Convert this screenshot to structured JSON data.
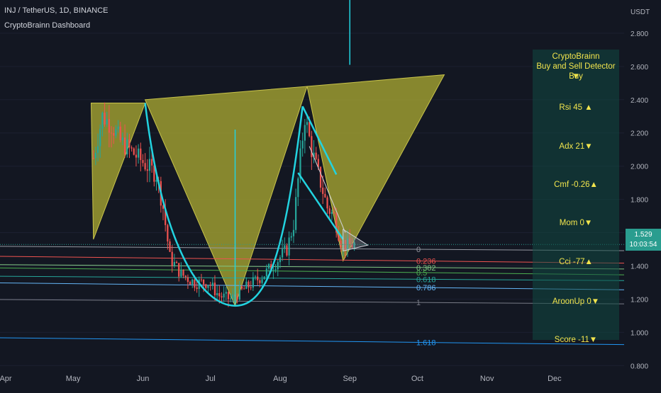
{
  "header": {
    "symbol": "INJ / TetherUS, 1D, BINANCE",
    "indicator": "CryptoBrainn Dashboard"
  },
  "price_tag": {
    "price": "1.529",
    "countdown": "10:03:54"
  },
  "dashboard": {
    "title1": "CryptoBrainn",
    "title2": "Buy and Sell Detector  Buy",
    "title_arrow": "▼",
    "rows": [
      {
        "label": "Rsi  45 ▲"
      },
      {
        "label": "Adx  21▼"
      },
      {
        "label": "Cmf -0.26▲"
      },
      {
        "label": "Mom  0▼"
      },
      {
        "label": "Cci    -77▲"
      },
      {
        "label": "AroonUp  0▼"
      },
      {
        "label": "Score  -11▼"
      }
    ]
  },
  "colors": {
    "background": "#131722",
    "up": "#26a69a",
    "down": "#ef5350",
    "pattern_fill": "#a8a632",
    "cyan": "#22d3e0",
    "panel": "#104842",
    "panel_text": "#f2e54d"
  },
  "chart_data": {
    "type": "candlestick",
    "pair": "INJ / TetherUS",
    "interval": "1D",
    "exchange": "BINANCE",
    "y_unit": "USDT",
    "ylim": [
      0.78,
      3.0
    ],
    "xlim": [
      "2023-04-01",
      "2023-12-31"
    ],
    "y_ticks": [
      0.8,
      1.0,
      1.2,
      1.4,
      1.6,
      1.8,
      2.0,
      2.2,
      2.4,
      2.6,
      2.8
    ],
    "y_tick_labels": [
      "0.800",
      "1.000",
      "1.200",
      "1.400",
      "1.600",
      "1.800",
      "2.000",
      "2.200",
      "2.400",
      "2.600",
      "2.800"
    ],
    "x_ticks": [
      {
        "label": "Apr",
        "date": "2023-04-01"
      },
      {
        "label": "May",
        "date": "2023-05-01"
      },
      {
        "label": "Jun",
        "date": "2023-06-01"
      },
      {
        "label": "Jul",
        "date": "2023-07-01"
      },
      {
        "label": "Aug",
        "date": "2023-08-01"
      },
      {
        "label": "Sep",
        "date": "2023-09-01"
      },
      {
        "label": "Oct",
        "date": "2023-10-01"
      },
      {
        "label": "Nov",
        "date": "2023-11-01"
      },
      {
        "label": "Dec",
        "date": "2023-12-01"
      }
    ],
    "last_price": 1.529,
    "close_path": [
      [
        "2023-05-10",
        2.05
      ],
      [
        "2023-05-14",
        2.3
      ],
      [
        "2023-05-18",
        2.25
      ],
      [
        "2023-05-22",
        2.15
      ],
      [
        "2023-05-26",
        2.1
      ],
      [
        "2023-05-30",
        2.05
      ],
      [
        "2023-06-03",
        2.0
      ],
      [
        "2023-06-07",
        1.95
      ],
      [
        "2023-06-10",
        1.75
      ],
      [
        "2023-06-13",
        1.45
      ],
      [
        "2023-06-18",
        1.35
      ],
      [
        "2023-06-24",
        1.3
      ],
      [
        "2023-06-30",
        1.3
      ],
      [
        "2023-07-05",
        1.22
      ],
      [
        "2023-07-10",
        1.2
      ],
      [
        "2023-07-15",
        1.25
      ],
      [
        "2023-07-20",
        1.3
      ],
      [
        "2023-07-25",
        1.35
      ],
      [
        "2023-07-30",
        1.42
      ],
      [
        "2023-08-04",
        1.5
      ],
      [
        "2023-08-07",
        1.65
      ],
      [
        "2023-08-10",
        2.05
      ],
      [
        "2023-08-12",
        2.3
      ],
      [
        "2023-08-15",
        2.1
      ],
      [
        "2023-08-18",
        1.95
      ],
      [
        "2023-08-22",
        1.75
      ],
      [
        "2023-08-25",
        1.7
      ],
      [
        "2023-08-28",
        1.55
      ],
      [
        "2023-08-31",
        1.52
      ],
      [
        "2023-09-03",
        1.53
      ]
    ],
    "fibonacci_levels": [
      {
        "label": "0",
        "price": 1.5,
        "color": "#9598a1"
      },
      {
        "label": "0.236",
        "price": 1.43,
        "color": "#ef5350"
      },
      {
        "label": "0.382",
        "price": 1.39,
        "color": "#81c784"
      },
      {
        "label": "0.5",
        "price": 1.36,
        "color": "#4caf50"
      },
      {
        "label": "0.618",
        "price": 1.32,
        "color": "#26a69a"
      },
      {
        "label": "0.786",
        "price": 1.27,
        "color": "#64b5f6"
      },
      {
        "label": "1",
        "price": 1.18,
        "color": "#787b86"
      },
      {
        "label": "1.618",
        "price": 0.94,
        "color": "#2196f3"
      }
    ],
    "triangles": [
      {
        "points": [
          [
            "2023-05-09",
            2.38
          ],
          [
            "2023-06-02",
            2.38
          ],
          [
            "2023-05-10",
            1.56
          ]
        ]
      },
      {
        "points": [
          [
            "2023-06-02",
            2.4
          ],
          [
            "2023-07-12",
            1.16
          ],
          [
            "2023-08-13",
            2.48
          ]
        ]
      },
      {
        "points": [
          [
            "2023-08-13",
            2.48
          ],
          [
            "2023-10-13",
            2.55
          ],
          [
            "2023-08-29",
            1.43
          ]
        ]
      }
    ],
    "bowl_curves": [
      {
        "from": [
          "2023-06-02",
          2.38
        ],
        "bottom": [
          "2023-07-12",
          1.16
        ],
        "to": [
          "2023-08-11",
          2.36
        ]
      }
    ]
  }
}
